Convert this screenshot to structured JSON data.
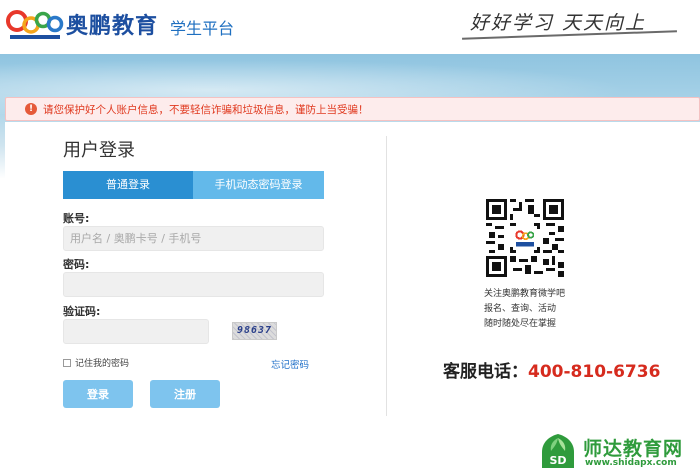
{
  "header": {
    "logo_letters": "Open",
    "brand_name": "奥鹏教育",
    "platform": "学生平台",
    "slogan": "好好学习  天天向上"
  },
  "warning": {
    "icon": "exclamation-icon",
    "text": "请您保护好个人账户信息，不要轻信诈骗和垃圾信息，谨防上当受骗！"
  },
  "login": {
    "title": "用户登录",
    "tabs": [
      {
        "label": "普通登录",
        "active": true
      },
      {
        "label": "手机动态密码登录",
        "active": false
      }
    ],
    "account_label": "账号:",
    "account_placeholder": "用户名 / 奥鹏卡号 / 手机号",
    "password_label": "密码:",
    "captcha_label": "验证码:",
    "captcha_value": "98637",
    "remember_label": "记住我的密码",
    "forgot_label": "忘记密码",
    "login_button": "登录",
    "register_button": "注册"
  },
  "side": {
    "qr_caption": [
      "关注奥鹏教育微学吧",
      "报名、查询、活动",
      "随时随处尽在掌握"
    ],
    "hotline_label": "客服电话：",
    "hotline_number": "400-810-6736"
  },
  "watermark": {
    "title": "师达教育网",
    "url": "www.shidapx.com",
    "badge": "SD"
  },
  "colors": {
    "brand_blue": "#1d4fa0",
    "tab_active": "#2a8fd2",
    "tab_inactive": "#63b9ea",
    "button": "#7ec4ee",
    "warning_text": "#e0391f",
    "hotline_red": "#d62b1e",
    "watermark_green": "#2f9b3c"
  }
}
